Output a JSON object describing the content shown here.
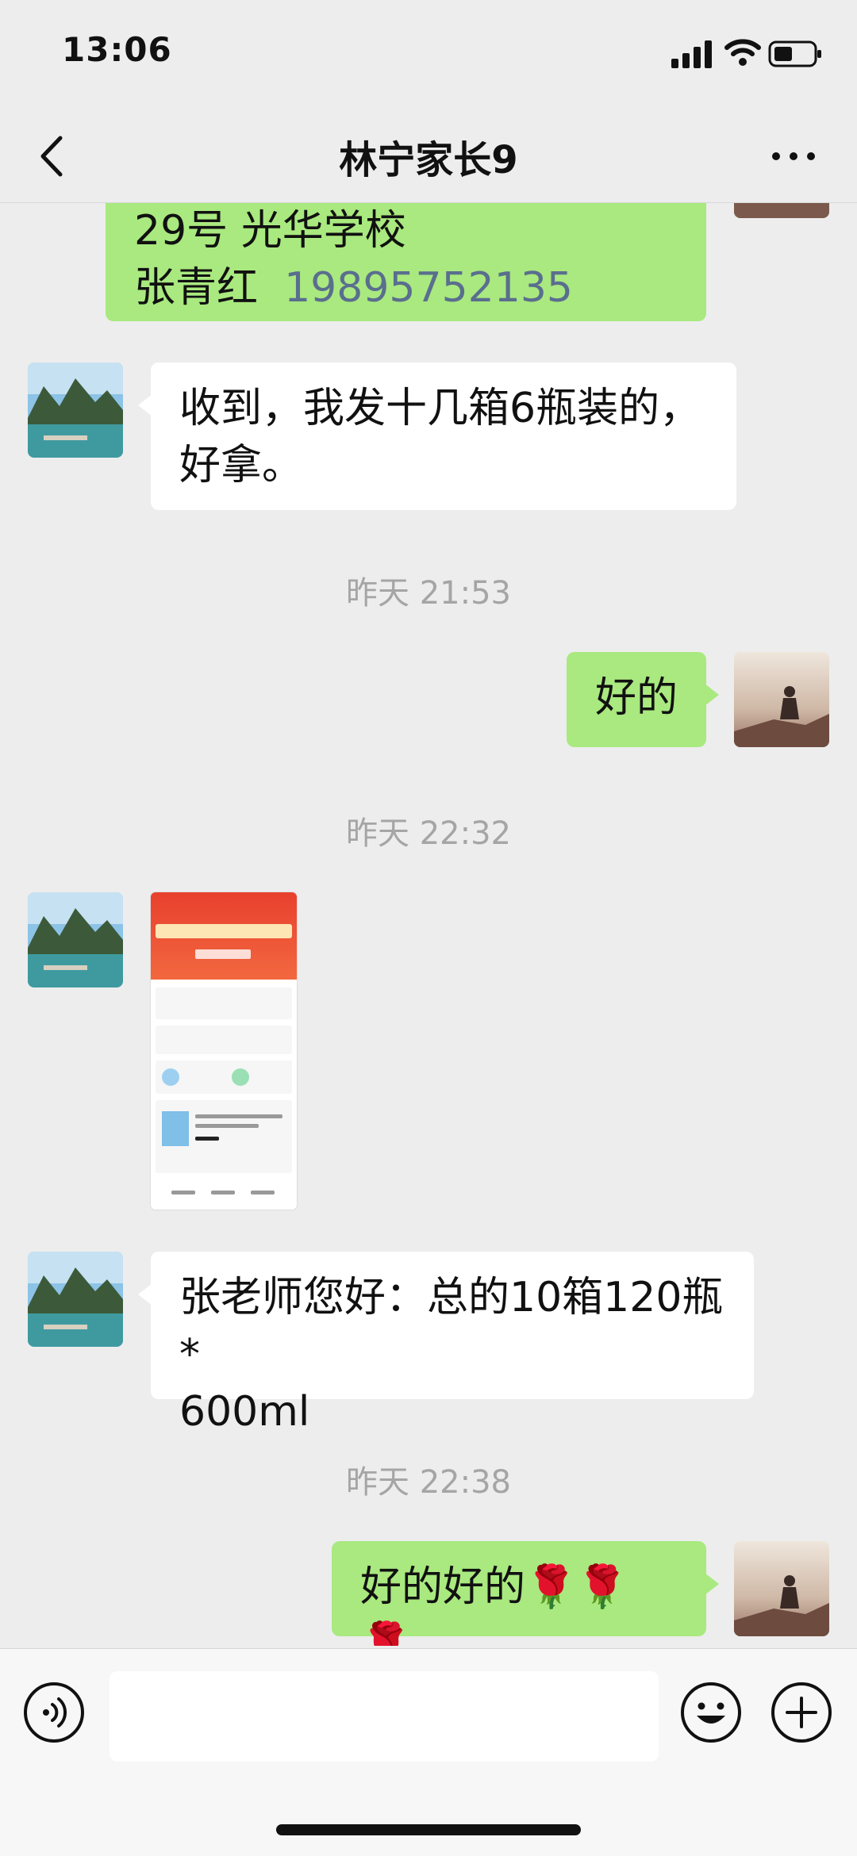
{
  "status_bar": {
    "time": "13:06"
  },
  "nav": {
    "title": "林宁家长9"
  },
  "messages": {
    "m1": {
      "line1": "29号 光华学校",
      "name": "张青红",
      "phone": "19895752135"
    },
    "m2": {
      "line1": "收到，我发十几箱6瓶装的，",
      "line2": "好拿。"
    },
    "ts1": "昨天 21:53",
    "m3": {
      "text": "好的"
    },
    "ts2": "昨天 22:32",
    "m5": {
      "line1": "张老师您好：总的10箱120瓶*",
      "line2": " 600ml"
    },
    "ts3": "昨天 22:38",
    "m6": {
      "text": "好的好的🌹🌹🌹"
    }
  },
  "input": {
    "placeholder": ""
  },
  "icons": {
    "back": "chevron-left-icon",
    "more": "more-dots-icon",
    "voice": "voice-icon",
    "emoji": "emoji-icon",
    "plus": "plus-icon"
  },
  "colors": {
    "sent_bubble": "#a9e97f",
    "received_bubble": "#ffffff",
    "background": "#ededed"
  }
}
